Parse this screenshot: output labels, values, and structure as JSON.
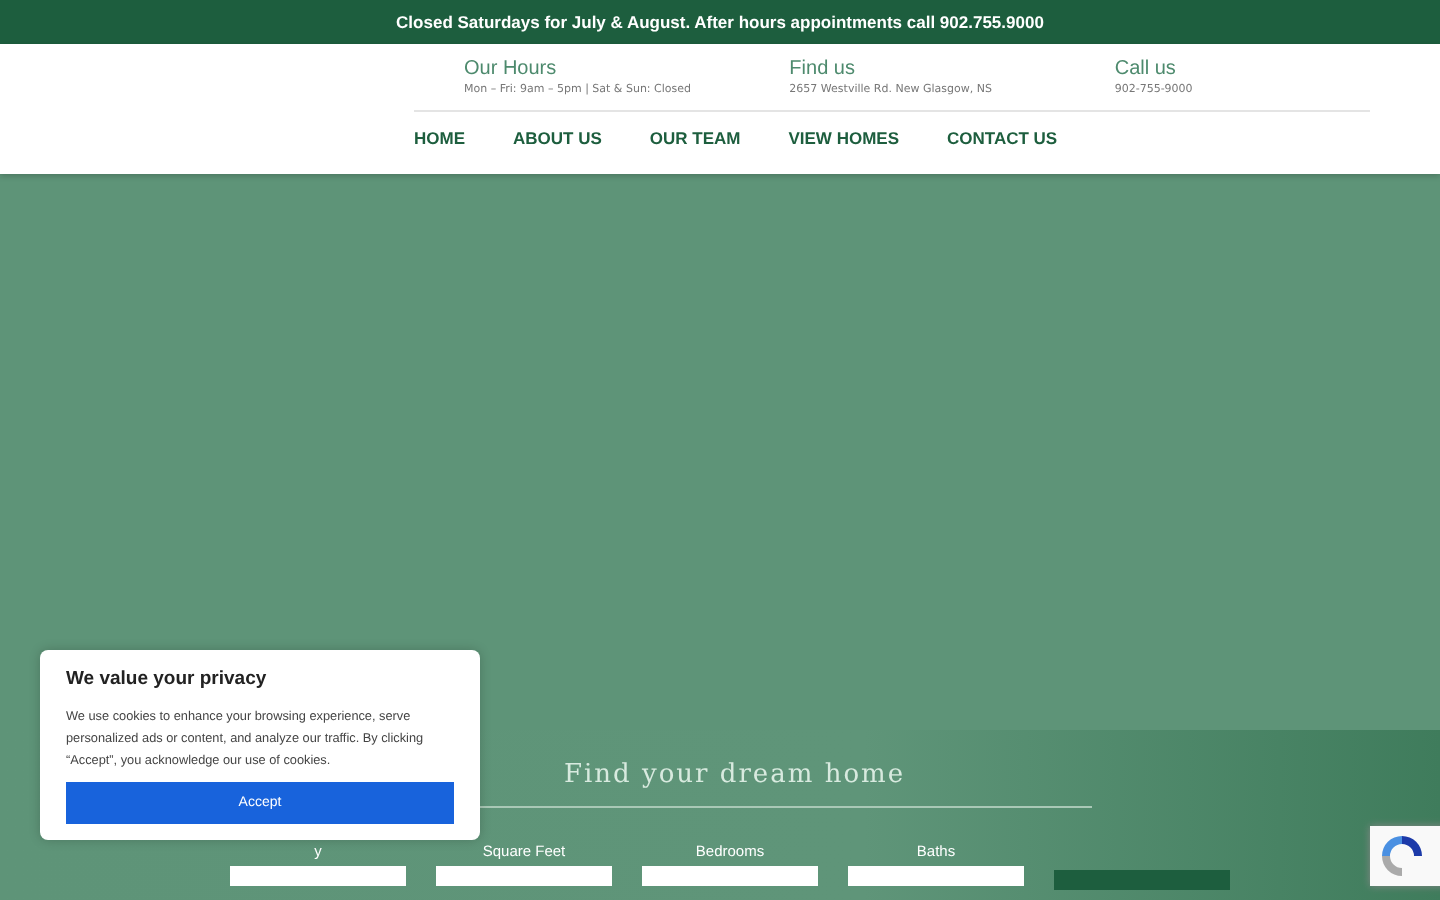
{
  "announcement": "Closed Saturdays for July & August. After hours appointments call 902.755.9000",
  "info": [
    {
      "title": "Our Hours",
      "detail": "Mon – Fri: 9am – 5pm | Sat & Sun: Closed"
    },
    {
      "title": "Find us",
      "detail": "2657 Westville Rd. New Glasgow, NS"
    },
    {
      "title": "Call us",
      "detail": "902-755-9000"
    }
  ],
  "nav": [
    "HOME",
    "ABOUT US",
    "OUR TEAM",
    "VIEW HOMES",
    "CONTACT US"
  ],
  "search": {
    "title": "Find your dream home",
    "fields": [
      {
        "label": "y"
      },
      {
        "label": "Square Feet"
      },
      {
        "label": "Bedrooms"
      },
      {
        "label": "Baths"
      }
    ]
  },
  "cookie": {
    "title": "We value your privacy",
    "text": "We use cookies to enhance your browsing experience, serve personalized ads or content, and analyze our traffic. By clicking “Accept”, you acknowledge our use of cookies.",
    "button": "Accept"
  }
}
